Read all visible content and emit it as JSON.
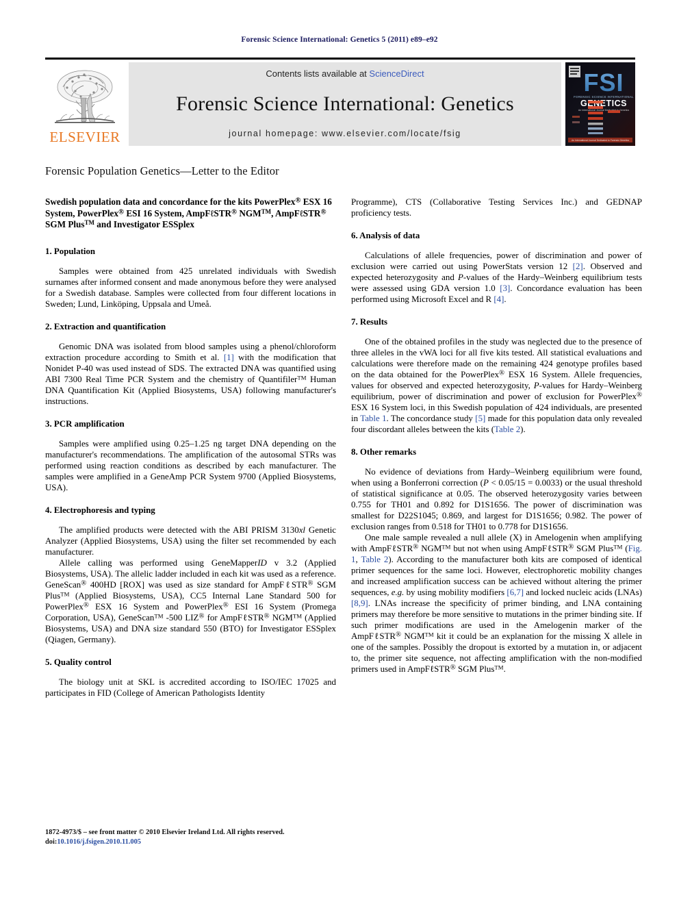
{
  "running_header": "Forensic Science International: Genetics 5 (2011) e89–e92",
  "masthead": {
    "contents_prefix": "Contents lists available at ",
    "sciencedirect_link": "ScienceDirect",
    "journal_title": "Forensic Science International: Genetics",
    "homepage": "journal homepage: www.elsevier.com/locate/fsig",
    "publisher_logo_text": "ELSEVIER",
    "cover": {
      "brand": "FSI",
      "subtitle": "GENETICS",
      "tagline": "FORENSIC SCIENCE INTERNATIONAL",
      "footer_strip": "An International Journal Dedicated to the Applications of Genetics"
    },
    "accent_orange": "#E87722",
    "link_blue": "#3b5bbd",
    "header_blue": "#1a1a5e",
    "masthead_gray": "#e4e4e4"
  },
  "article_type": "Forensic Population Genetics—Letter to the Editor",
  "article_title_html": "Swedish population data and concordance for the kits PowerPlex<span class=\"reg\">®</span> ESX 16 System, PowerPlex<span class=\"reg\">®</span> ESI 16 System, AmpFℓSTR<span class=\"reg\">®</span> NGM<sup>TM</sup>, AmpFℓSTR<span class=\"reg\">®</span> SGM Plus<sup>TM</sup> and Investigator ESSplex",
  "sections": [
    {
      "number": "1.",
      "heading": "1. Population",
      "paragraphs_html": [
        "Samples were obtained from 425 unrelated individuals with Swedish surnames after informed consent and made anonymous before they were analysed for a Swedish database. Samples were collected from four different locations in Sweden; Lund, Linköping, Uppsala and Umeå."
      ]
    },
    {
      "number": "2.",
      "heading": "2. Extraction and quantification",
      "paragraphs_html": [
        "Genomic DNA was isolated from blood samples using a phenol/chloroform extraction procedure according to Smith et al. <span class=\"lnk\">[1]</span> with the modification that Nonidet P-40 was used instead of SDS. The extracted DNA was quantified using ABI 7300 Real Time PCR System and the chemistry of Quantifiler<sup>TM</sup> Human DNA Quantification Kit (Applied Biosystems, USA) following manufacturer's instructions."
      ]
    },
    {
      "number": "3.",
      "heading": "3. PCR amplification",
      "paragraphs_html": [
        "Samples were amplified using 0.25–1.25 ng target DNA depending on the manufacturer's recommendations. The amplification of the autosomal STRs was performed using reaction conditions as described by each manufacturer. The samples were amplified in a GeneAmp PCR System 9700 (Applied Biosystems, USA)."
      ]
    },
    {
      "number": "4.",
      "heading": "4. Electrophoresis and typing",
      "paragraphs_html": [
        "The amplified products were detected with the ABI PRISM 3130<em>xl</em> Genetic Analyzer (Applied Biosystems, USA) using the filter set recommended by each manufacturer.",
        "Allele calling was performed using GeneMapper<em>ID</em> v 3.2 (Applied Biosystems, USA). The allelic ladder included in each kit was used as a reference. GeneScan<span class=\"reg\">®</span> 400HD [ROX] was used as size standard for AmpFℓSTR<span class=\"reg\">®</span> SGM Plus<sup>TM</sup> (Applied Biosystems, USA), CC5 Internal Lane Standard 500 for PowerPlex<span class=\"reg\">®</span> ESX 16 System and PowerPlex<span class=\"reg\">®</span> ESI 16 System (Promega Corporation, USA), GeneScan<sup>TM</sup> -500 LIZ<span class=\"reg\">®</span> for AmpFℓSTR<span class=\"reg\">®</span> NGM<sup>TM</sup> (Applied Biosystems, USA) and DNA size standard 550 (BTO) for Investigator ESSplex (Qiagen, Germany)."
      ]
    },
    {
      "number": "5.",
      "heading": "5. Quality control",
      "paragraphs_html": [
        "The biology unit at SKL is accredited according to ISO/IEC 17025 and participates in FID (College of American Pathologists Identity"
      ]
    },
    {
      "number": "5b",
      "heading": "",
      "paragraphs_html": [
        "Programme), CTS (Collaborative Testing Services Inc.) and GEDNAP proficiency tests."
      ]
    },
    {
      "number": "6.",
      "heading": "6. Analysis of data",
      "paragraphs_html": [
        "Calculations of allele frequencies, power of discrimination and power of exclusion were carried out using PowerStats version 12 <span class=\"lnk\">[2]</span>. Observed and expected heterozygosity and <em>P</em>-values of the Hardy–Weinberg equilibrium tests were assessed using GDA version 1.0 <span class=\"lnk\">[3]</span>. Concordance evaluation has been performed using Microsoft Excel and R <span class=\"lnk\">[4]</span>."
      ]
    },
    {
      "number": "7.",
      "heading": "7. Results",
      "paragraphs_html": [
        "One of the obtained profiles in the study was neglected due to the presence of three alleles in the vWA loci for all five kits tested. All statistical evaluations and calculations were therefore made on the remaining 424 genotype profiles based on the data obtained for the PowerPlex<span class=\"reg\">®</span> ESX 16 System. Allele frequencies, values for observed and expected heterozygosity, <em>P</em>-values for Hardy–Weinberg equilibrium, power of discrimination and power of exclusion for PowerPlex<span class=\"reg\">®</span> ESX 16 System loci, in this Swedish population of 424 individuals, are presented in <span class=\"lnk\">Table 1</span>. The concordance study <span class=\"lnk\">[5]</span> made for this population data only revealed four discordant alleles between the kits (<span class=\"lnk\">Table 2</span>)."
      ]
    },
    {
      "number": "8.",
      "heading": "8. Other remarks",
      "paragraphs_html": [
        "No evidence of deviations from Hardy–Weinberg equilibrium were found, when using a Bonferroni correction (<em>P</em> &lt; 0.05/15 = 0.0033) or the usual threshold of statistical significance at 0.05. The observed heterozygosity varies between 0.755 for TH01 and 0.892 for D1S1656. The power of discrimination was smallest for D22S1045; 0.869, and largest for D1S1656; 0.982. The power of exclusion ranges from 0.518 for TH01 to 0.778 for D1S1656.",
        "One male sample revealed a null allele (X) in Amelogenin when amplifying with AmpFℓSTR<span class=\"reg\">®</span> NGM<sup>TM</sup> but not when using AmpFℓSTR<span class=\"reg\">®</span> SGM Plus<sup>TM</sup> (<span class=\"lnk\">Fig. 1</span>, <span class=\"lnk\">Table 2</span>). According to the manufacturer both kits are composed of identical primer sequences for the same loci. However, electrophoretic mobility changes and increased amplification success can be achieved without altering the primer sequences, <em>e.g.</em> by using mobility modifiers <span class=\"lnk\">[6,7]</span> and locked nucleic acids (LNAs) <span class=\"lnk\">[8,9]</span>. LNAs increase the specificity of primer binding, and LNA containing primers may therefore be more sensitive to mutations in the primer binding site. If such primer modifications are used in the Amelogenin marker of the AmpFℓSTR<span class=\"reg\">®</span> NGM<sup>TM</sup> kit it could be an explanation for the missing X allele in one of the samples. Possibly the dropout is extorted by a mutation in, or adjacent to, the primer site sequence, not affecting amplification with the non-modified primers used in AmpFℓSTR<span class=\"reg\">®</span> SGM Plus<sup>TM</sup>."
      ]
    }
  ],
  "footer": {
    "front_matter": "1872-4973/$ – see front matter © 2010 Elsevier Ireland Ltd. All rights reserved.",
    "doi_label": "doi:",
    "doi_value": "10.1016/j.fsigen.2010.11.005"
  }
}
